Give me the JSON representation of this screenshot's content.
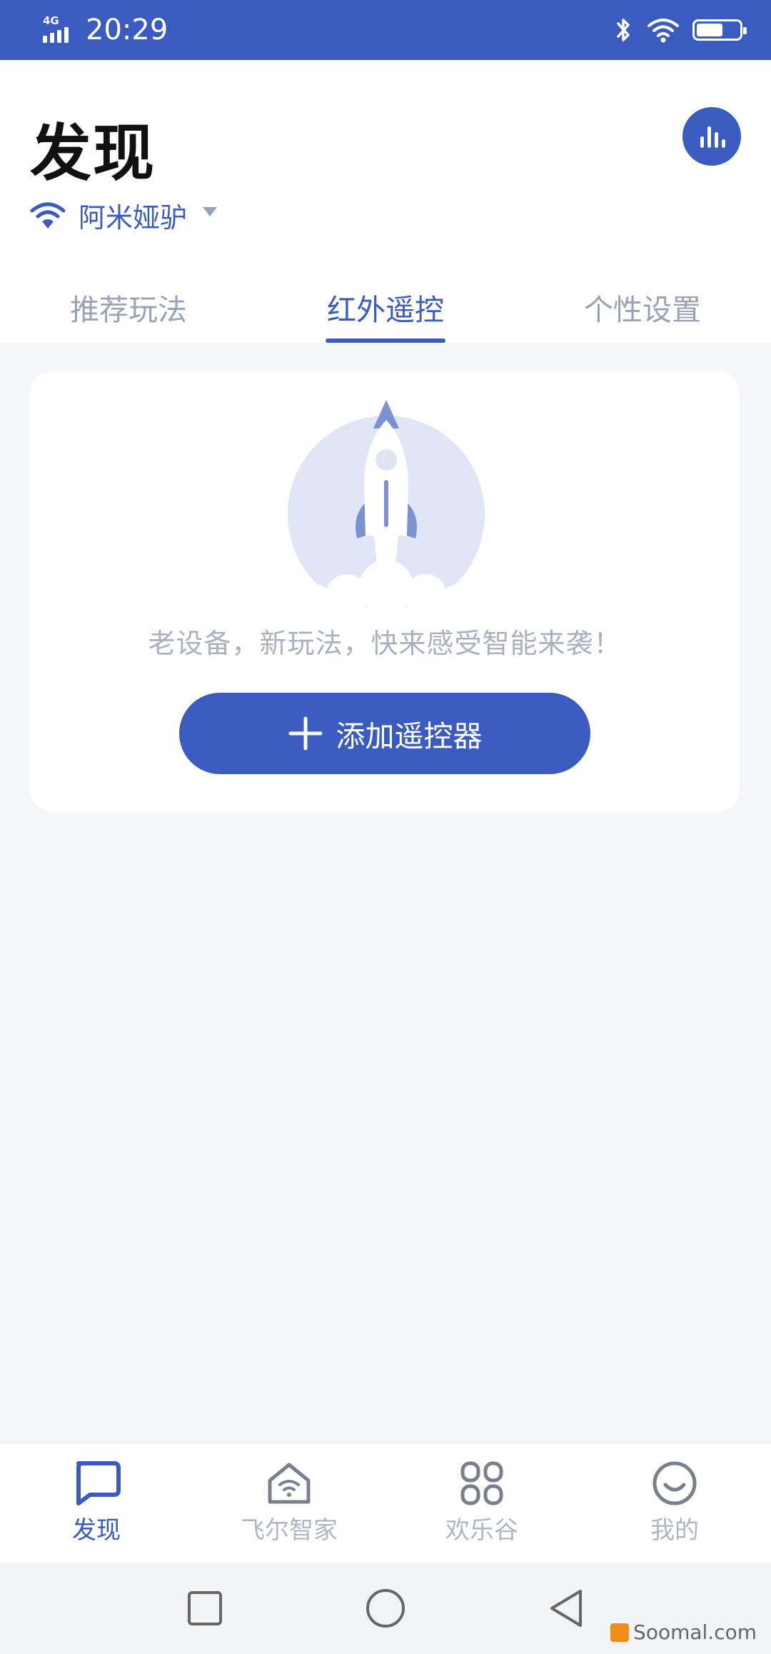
{
  "status_bar": {
    "network_type": "4G",
    "time": "20:29",
    "icons": [
      "bluetooth-icon",
      "wifi-icon",
      "battery-icon"
    ],
    "battery_level": 0.6
  },
  "header": {
    "title": "发现",
    "stats_icon": "bar-chart-icon",
    "network": {
      "icon": "wifi-icon",
      "name": "阿米娅驴"
    }
  },
  "tabs": [
    {
      "label": "推荐玩法",
      "active": false
    },
    {
      "label": "红外遥控",
      "active": true
    },
    {
      "label": "个性设置",
      "active": false
    }
  ],
  "card": {
    "illustration": "rocket-icon",
    "empty_text": "老设备，新玩法，快来感受智能来袭！",
    "add_button_label": "添加遥控器"
  },
  "bottom_nav": [
    {
      "label": "发现",
      "icon": "chat-bubble-icon",
      "active": true
    },
    {
      "label": "飞尔智家",
      "icon": "home-wifi-icon",
      "active": false
    },
    {
      "label": "欢乐谷",
      "icon": "grid-icon",
      "active": false
    },
    {
      "label": "我的",
      "icon": "smiley-icon",
      "active": false
    }
  ],
  "system_nav": [
    "recents-square-icon",
    "home-circle-icon",
    "back-triangle-icon"
  ],
  "watermark": "Soomal.com",
  "colors": {
    "accent": "#3a5bbf",
    "muted": "#9aa3b5",
    "background": "#f4f6fa"
  }
}
